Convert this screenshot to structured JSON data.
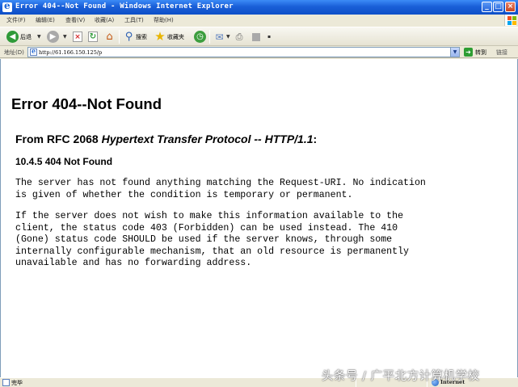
{
  "window": {
    "title": "Error 404--Not Found - Windows Internet Explorer",
    "minimize_glyph": "_",
    "maximize_glyph": "□",
    "close_glyph": "×"
  },
  "menu": {
    "items": [
      "文件(F)",
      "编辑(E)",
      "查看(V)",
      "收藏(A)",
      "工具(T)",
      "帮助(H)"
    ]
  },
  "toolbar": {
    "back_label": "后退",
    "search_label": "搜索",
    "favorites_label": "收藏夹",
    "icons": [
      "back-icon",
      "forward-icon",
      "stop-icon",
      "refresh-icon",
      "home-icon",
      "search-icon",
      "favorites-icon",
      "history-icon",
      "mail-icon",
      "print-icon",
      "edit-icon"
    ]
  },
  "address_bar": {
    "label": "地址(D)",
    "url": "http://61.166.150.125/p",
    "go_label": "转到",
    "links_label": "链接"
  },
  "page": {
    "heading": "Error 404--Not Found",
    "rfc_prefix": "From RFC 2068 ",
    "rfc_title": "Hypertext Transfer Protocol -- HTTP/1.1",
    "rfc_suffix": ":",
    "section": "10.4.5 404 Not Found",
    "paragraph1": "The server has not found anything matching the Request-URI. No indication\nis given of whether the condition is temporary or permanent.",
    "paragraph2": "If the server does not wish to make this information available to the\nclient, the status code 403 (Forbidden) can be used instead. The 410\n(Gone) status code SHOULD be used if the server knows, through some\ninternally configurable mechanism, that an old resource is permanently\nunavailable and has no forwarding address."
  },
  "status_bar": {
    "status": "完毕",
    "zone": "Internet"
  },
  "watermark": {
    "text": "头条号 / 广平北方计算机学校"
  },
  "colors": {
    "titlebar": "#1a5fd8",
    "chrome": "#ece9d8",
    "content_bg": "#ffffff"
  }
}
